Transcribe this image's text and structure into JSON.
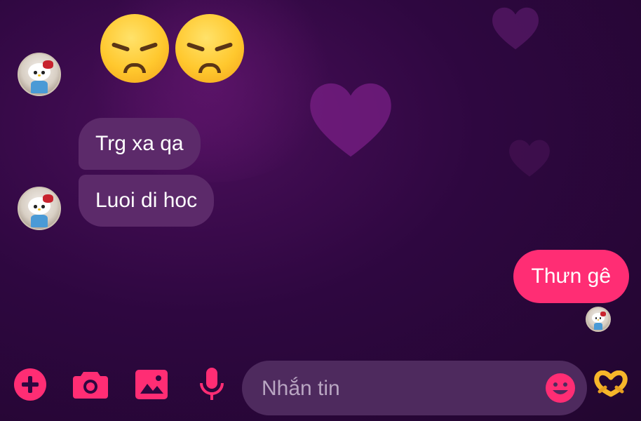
{
  "conversation": {
    "incoming_emojis": [
      "😞",
      "😞"
    ],
    "incoming_messages": [
      {
        "text": "Trg xa qa"
      },
      {
        "text": "Luoi di hoc"
      }
    ],
    "outgoing_messages": [
      {
        "text": "Thưn gê"
      }
    ]
  },
  "composer": {
    "placeholder": "Nhắn tin",
    "value": "",
    "icons": [
      "plus-icon",
      "camera-icon",
      "image-icon",
      "microphone-icon",
      "emoji-icon",
      "heart-hands-icon"
    ]
  },
  "colors": {
    "accent": "#ff2d74",
    "incoming_bubble": "#5c2a6a",
    "background": "#2e0740",
    "input_background": "#4e2a5e"
  }
}
